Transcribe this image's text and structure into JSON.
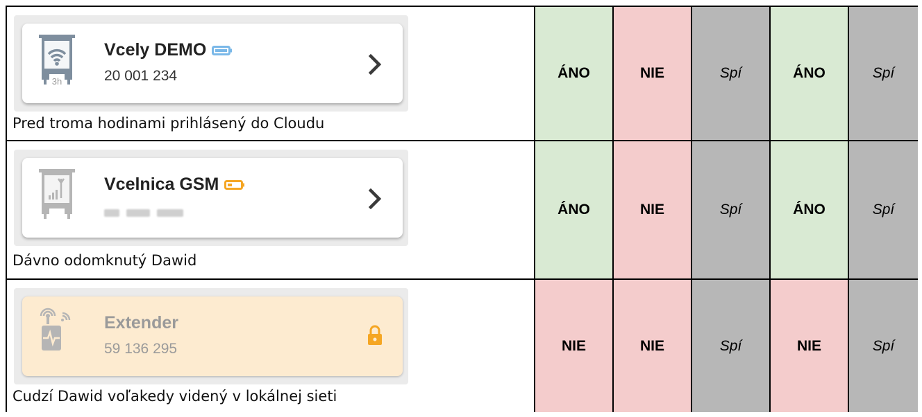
{
  "rows": [
    {
      "device": {
        "name": "Vcely DEMO",
        "serial": "20 001 234",
        "age": "3h",
        "icon": "hive-wifi-icon",
        "battery_icon": "battery-blue-icon",
        "battery_color": "#7ab8e8",
        "action_icon": "chevron-right-icon"
      },
      "description": "Pred troma hodinami prihlásený do Cloudu",
      "values": [
        "ÁNO",
        "NIE",
        "Spí",
        "ÁNO",
        "Spí"
      ]
    },
    {
      "device": {
        "name": "Vcelnica GSM",
        "icon": "hive-gsm-icon",
        "battery_icon": "battery-orange-icon",
        "battery_color": "#f5a623",
        "action_icon": "chevron-right-icon"
      },
      "description": "Dávno odomknutý Dawid",
      "values": [
        "ÁNO",
        "NIE",
        "Spí",
        "ÁNO",
        "Spí"
      ]
    },
    {
      "device": {
        "name": "Extender",
        "serial": "59 136 295",
        "icon": "extender-icon",
        "action_icon": "lock-icon",
        "lock_color": "#f5a623",
        "card_color": "#fdebd0"
      },
      "description": "Cudzí Dawid voľakedy videný v lokálnej sieti",
      "values": [
        "NIE",
        "NIE",
        "Spí",
        "NIE",
        "Spí"
      ]
    }
  ],
  "colors": {
    "ano": "#d9ead3",
    "nie": "#f4cccc",
    "spi": "#b7b7b7"
  }
}
